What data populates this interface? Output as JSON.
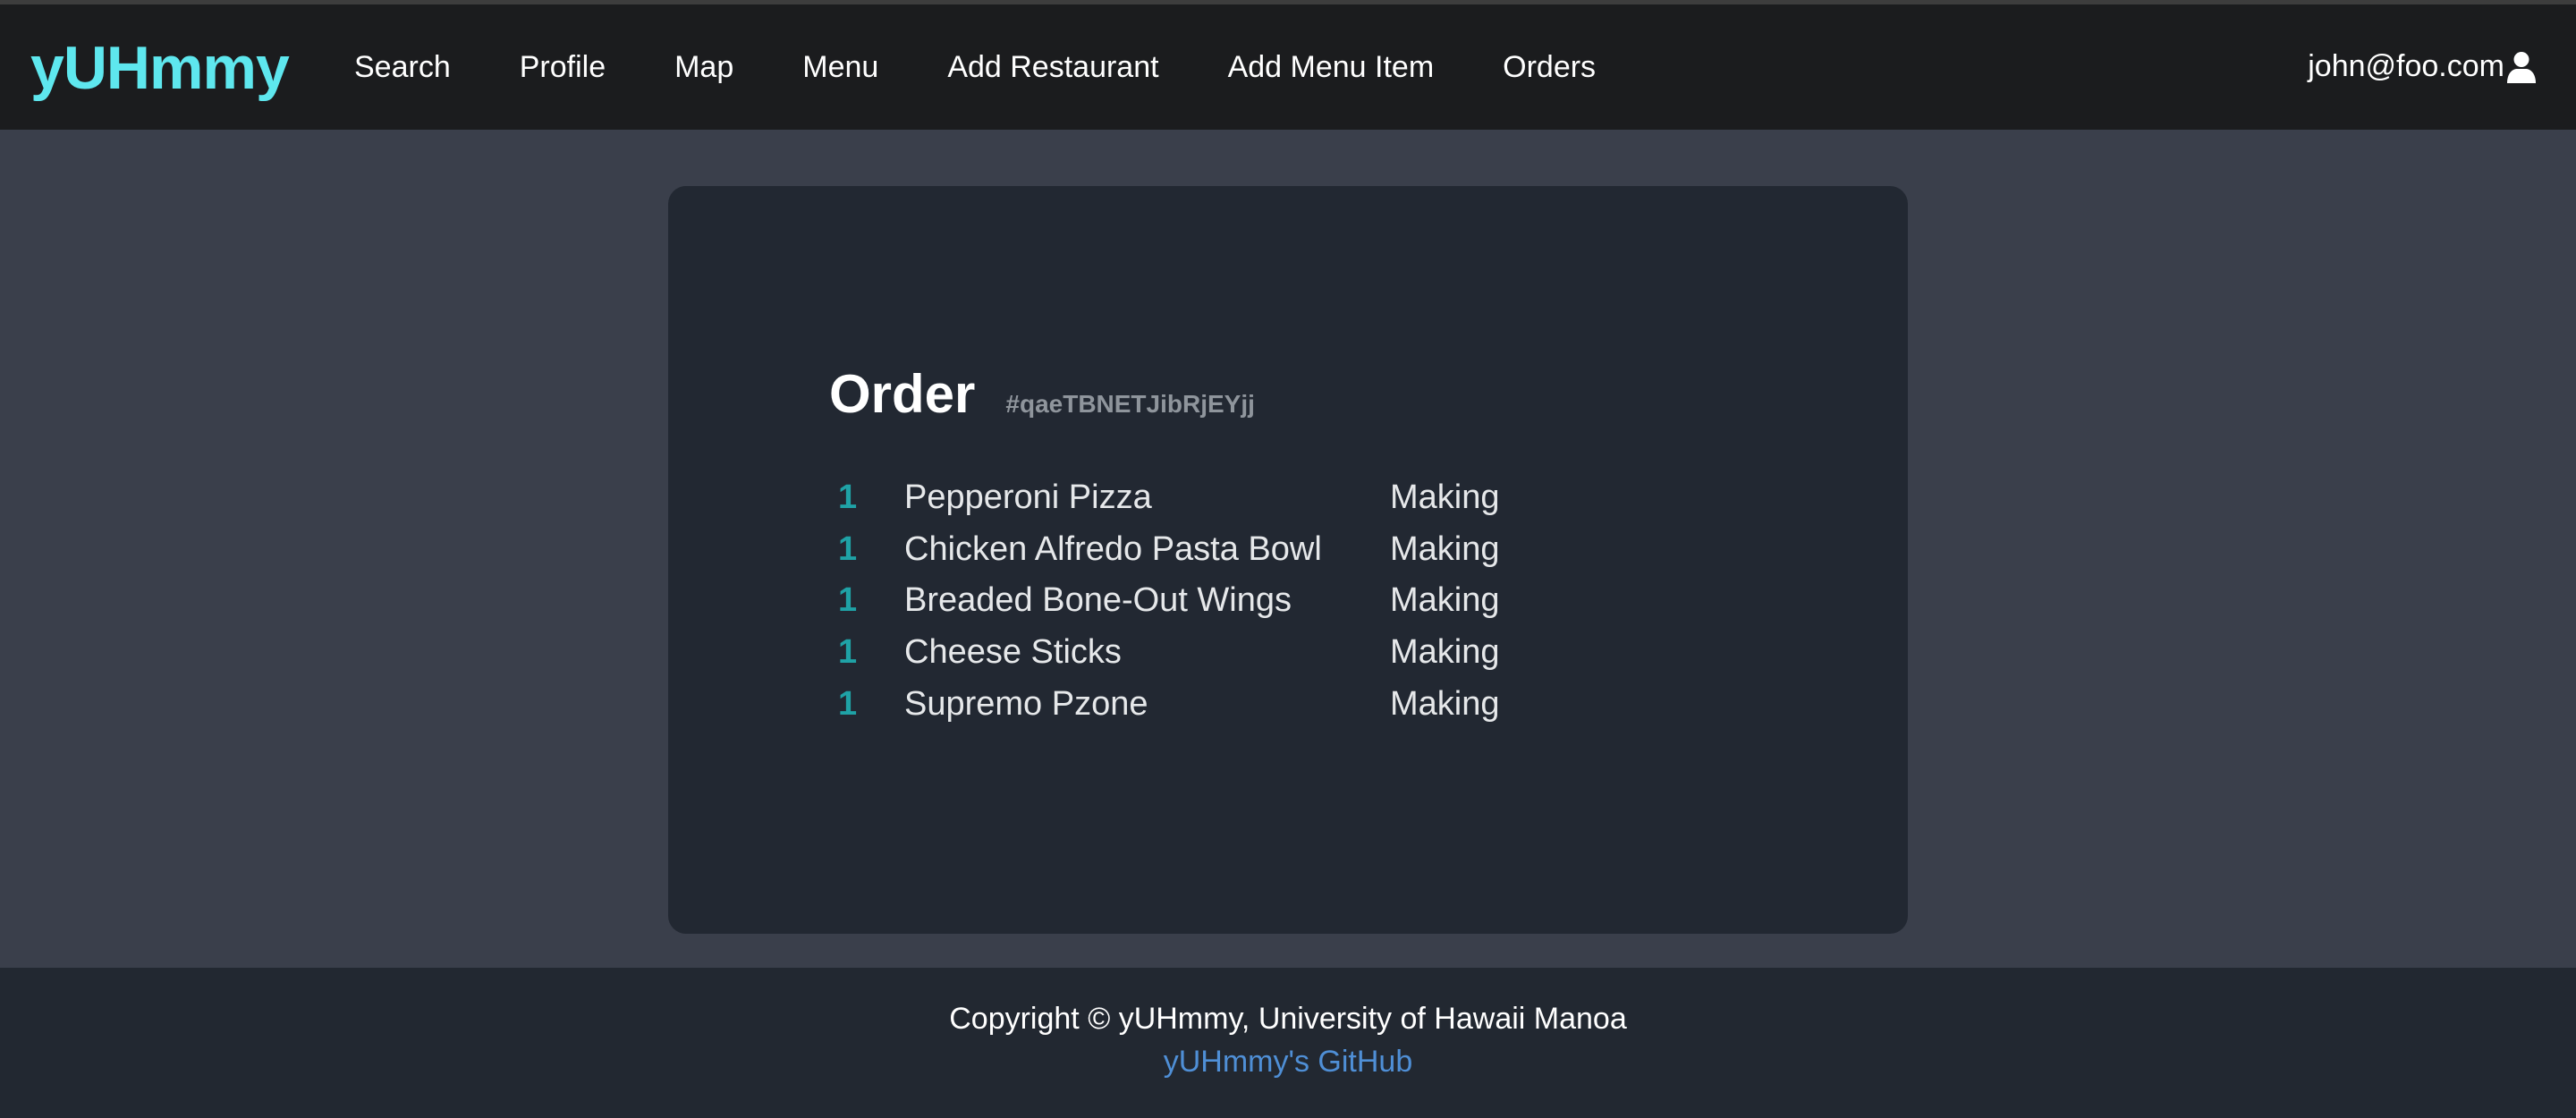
{
  "navbar": {
    "brand": "yUHmmy",
    "links": [
      {
        "label": "Search"
      },
      {
        "label": "Profile"
      },
      {
        "label": "Map"
      },
      {
        "label": "Menu"
      },
      {
        "label": "Add Restaurant"
      },
      {
        "label": "Add Menu Item"
      },
      {
        "label": "Orders"
      }
    ],
    "user_email": "john@foo.com",
    "user_icon": "user-icon"
  },
  "order": {
    "title": "Order",
    "id": "#qaeTBNETJibRjEYjj",
    "items": [
      {
        "qty": "1",
        "name": "Pepperoni Pizza",
        "status": "Making"
      },
      {
        "qty": "1",
        "name": "Chicken Alfredo Pasta Bowl",
        "status": "Making"
      },
      {
        "qty": "1",
        "name": "Breaded Bone-Out Wings",
        "status": "Making"
      },
      {
        "qty": "1",
        "name": "Cheese Sticks",
        "status": "Making"
      },
      {
        "qty": "1",
        "name": "Supremo Pzone",
        "status": "Making"
      }
    ]
  },
  "footer": {
    "copyright": "Copyright © yUHmmy, University of Hawaii Manoa",
    "github_link": "yUHmmy's GitHub"
  },
  "colors": {
    "brand": "#5ee7ee",
    "navbar_bg": "#1b1c1e",
    "page_bg": "#3a3f4b",
    "card_bg": "#222832",
    "qty_accent": "#1fa2a6",
    "link": "#4f8fd6"
  }
}
